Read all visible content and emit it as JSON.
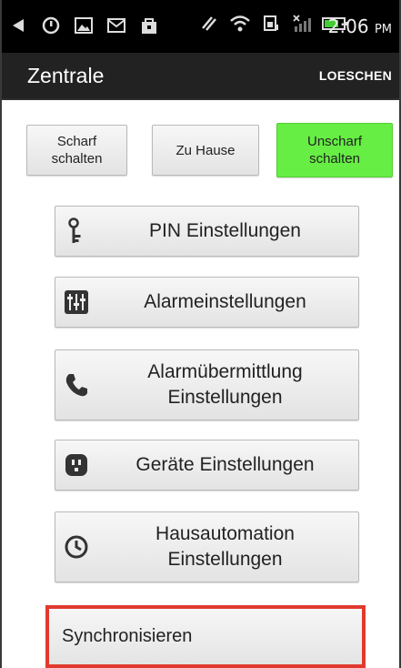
{
  "status_bar": {
    "time": "2:06",
    "time_suffix": "PM"
  },
  "action_bar": {
    "title": "Zentrale",
    "delete_label": "LOESCHEN"
  },
  "modes": [
    {
      "label": "Scharf\nschalten",
      "active": false
    },
    {
      "label": "Zu Hause",
      "active": false
    },
    {
      "label": "Unscharf\nschalten",
      "active": true,
      "color": "#66ee44"
    }
  ],
  "menu": [
    {
      "label": "PIN Einstellungen",
      "icon": "key-icon"
    },
    {
      "label": "Alarmeinstellungen",
      "icon": "sliders-icon"
    },
    {
      "label": "Alarmübermittlung\nEinstellungen",
      "icon": "phone-icon"
    },
    {
      "label": "Geräte Einstellungen",
      "icon": "device-icon"
    },
    {
      "label": "Hausautomation\nEinstellungen",
      "icon": "clock-icon"
    }
  ],
  "sync": {
    "label": "Synchronisieren",
    "highlight_color": "#e03a2e"
  }
}
